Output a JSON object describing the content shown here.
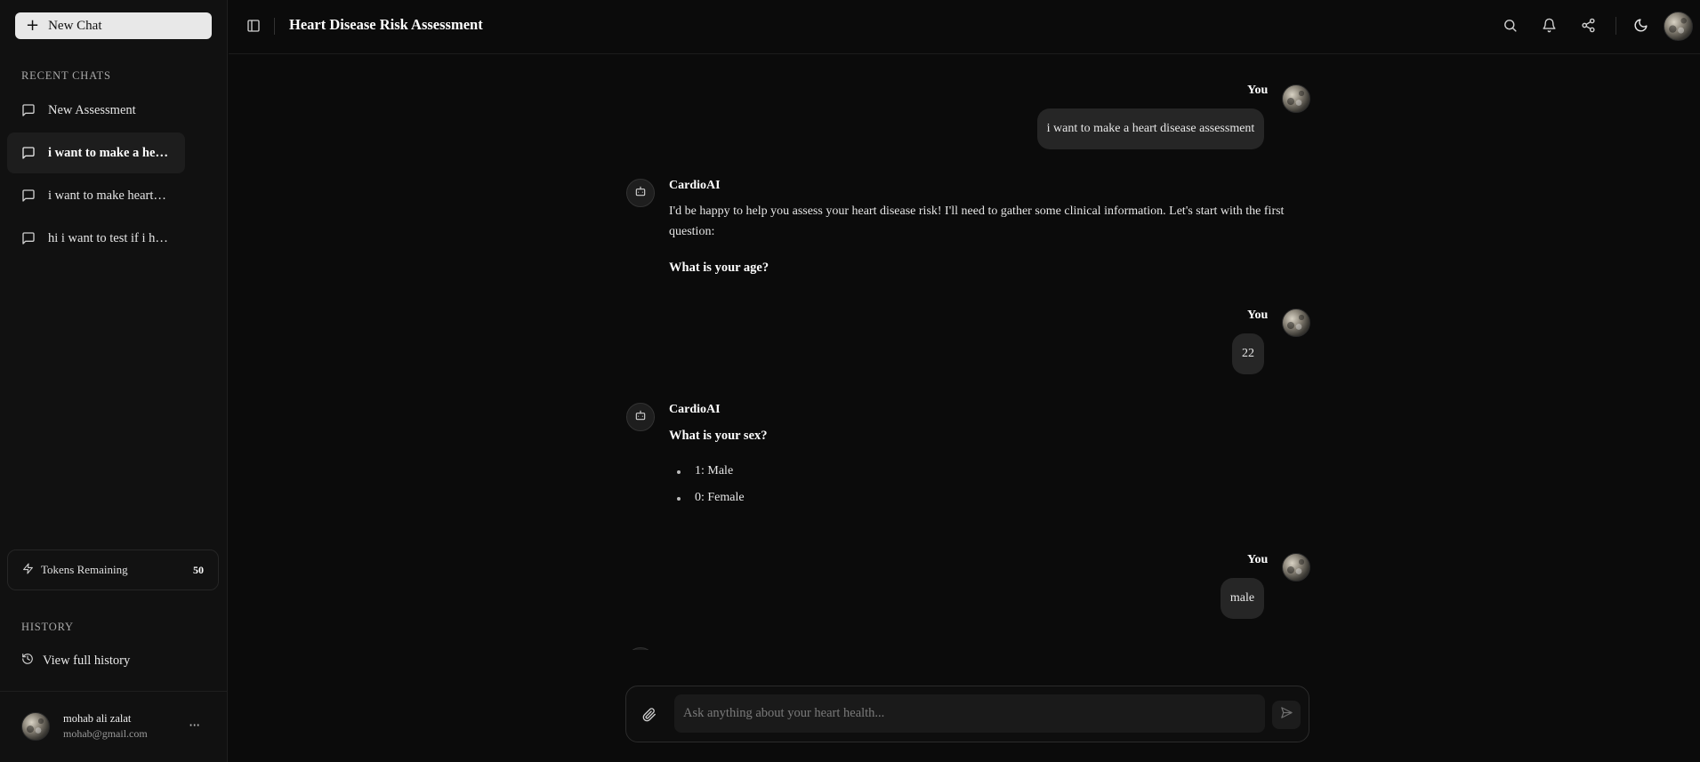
{
  "sidebar": {
    "new_chat_label": "New Chat",
    "recent_label": "RECENT CHATS",
    "chats": [
      {
        "label": "New Assessment"
      },
      {
        "label": "i want to make a heart disease assessment"
      },
      {
        "label": "i want to make heart disease assessment"
      },
      {
        "label": "hi i want to test if i have heart disease"
      }
    ],
    "tokens_label": "Tokens Remaining",
    "tokens_count": "50",
    "history_label": "HISTORY",
    "view_history_label": "View full history",
    "user": {
      "name": "mohab ali zalat",
      "email": "mohab@gmail.com"
    }
  },
  "header": {
    "title": "Heart Disease Risk Assessment"
  },
  "messages": {
    "m1": {
      "sender": "You",
      "text": "i want to make a heart disease assessment"
    },
    "m2": {
      "sender": "CardioAI",
      "line1": "I'd be happy to help you assess your heart disease risk! I'll need to gather some clinical information. Let's start with the first",
      "line2": "question:",
      "question": "What is your age?"
    },
    "m3": {
      "sender": "You",
      "text": "22"
    },
    "m4": {
      "sender": "CardioAI",
      "question": "What is your sex?",
      "options": [
        "1: Male",
        "0: Female"
      ]
    },
    "m5": {
      "sender": "You",
      "text": "male"
    }
  },
  "composer": {
    "placeholder": "Ask anything about your heart health..."
  },
  "icons": {
    "sidebar_toggle": "panel-left-icon",
    "search": "search-icon",
    "bell": "bell-icon",
    "share": "share-icon",
    "theme": "moon-icon",
    "chat": "message-square-icon",
    "tokens": "zap-icon",
    "history": "history-icon",
    "attach": "paperclip-icon",
    "send": "send-icon",
    "bot": "bot-icon"
  },
  "colors": {
    "background": "#0b0b0b",
    "sidebar": "#111111",
    "bubble": "#262626",
    "accent": "#e8e8e8"
  }
}
